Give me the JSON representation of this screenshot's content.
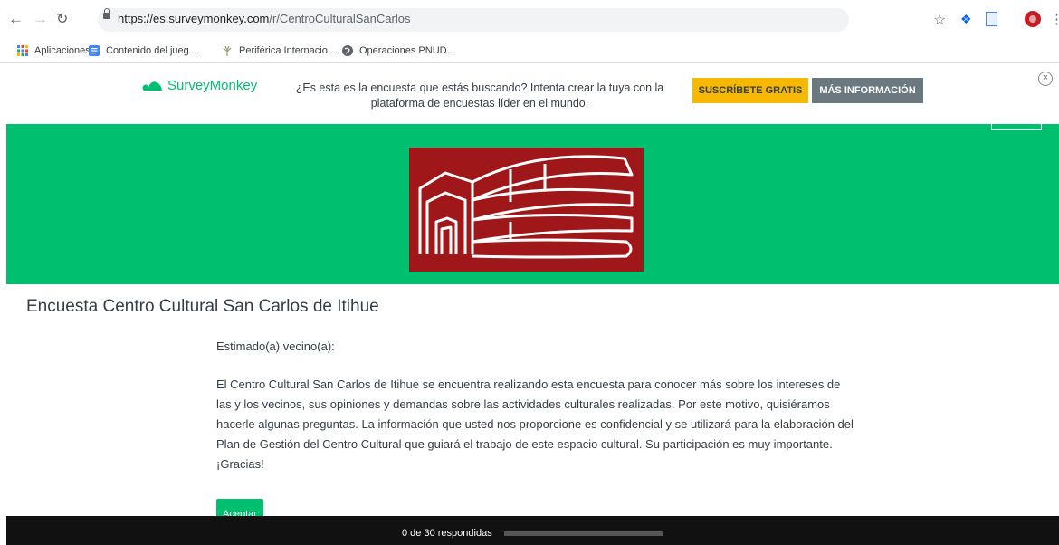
{
  "browser": {
    "url_host": "https://es.surveymonkey.com",
    "url_path": "/r/CentroCulturalSanCarlos",
    "bookmarks": [
      {
        "label": "Aplicaciones",
        "icon": "apps-grid-icon"
      },
      {
        "label": "Contenido del jueg...",
        "icon": "docs-icon"
      },
      {
        "label": "Periférica Internacio...",
        "icon": "plant-icon"
      },
      {
        "label": "Operaciones PNUD...",
        "icon": "globe-icon"
      }
    ]
  },
  "banner": {
    "brand": "SurveyMonkey",
    "message": "¿Es esta es la encuesta que estás buscando? Intenta crear la tuya con la plataforma de encuestas líder en el mundo.",
    "signup_label": "SUSCRÍBETE GRATIS",
    "info_label": "MÁS INFORMACIÓN",
    "close_glyph": "×",
    "brand_color": "#00bf6f",
    "signup_color": "#f6b800"
  },
  "survey": {
    "header_color": "#00bf6f",
    "logo_color": "#a0171a",
    "title": "Encuesta Centro Cultural San Carlos de Itihue",
    "greeting": "Estimado(a) vecino(a):",
    "body": "El Centro Cultural San Carlos de Itihue se encuentra realizando esta encuesta para conocer más sobre los intereses de las y los vecinos, sus opiniones y demandas sobre las actividades culturales realizadas. Por este motivo, quisiéramos hacerle algunas preguntas. La información que usted nos proporcione es confidencial y se utilizará para la elaboración del Plan de Gestión del Centro Cultural que guiará el trabajo de este espacio cultural. Su participación es muy importante. ¡Gracias!",
    "accept_label": "Aceptar"
  },
  "progress": {
    "label": "0 de 30 respondidas",
    "answered": 0,
    "total": 30
  }
}
